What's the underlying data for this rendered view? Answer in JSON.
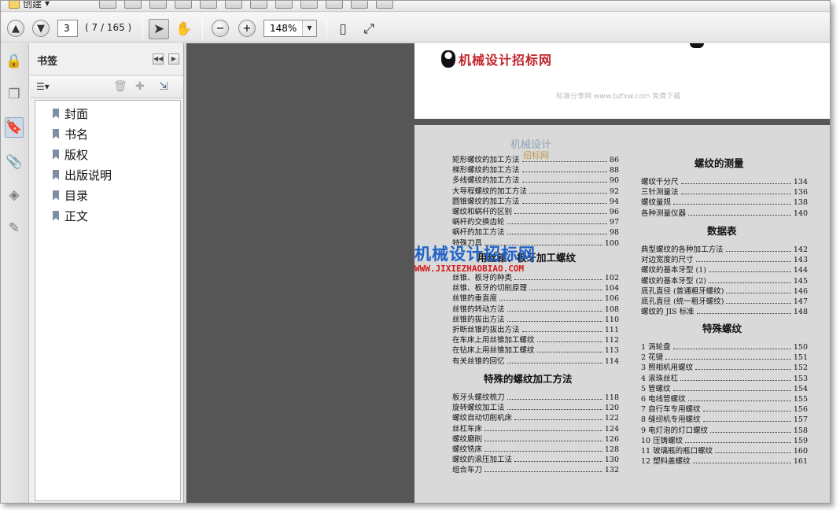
{
  "toolbar": {
    "create_label": "创建",
    "current_page": "3",
    "page_count": "( 7 / 165 )",
    "zoom": "148%"
  },
  "bookmarks": {
    "title": "书签",
    "items": [
      "封面",
      "书名",
      "版权",
      "出版说明",
      "目录",
      "正文"
    ]
  },
  "page1": {
    "logo_text": "机械设计招标网",
    "watermark": "标准分享网  www.bzfxw.com  免费下载"
  },
  "page2": {
    "watermark_top": "机械设计",
    "watermark_top2": "招标网",
    "watermark_mid": "机械设计招标网",
    "watermark_url": "WWW.JIXIEZHAOBIAO.COM",
    "left_col_top": [
      {
        "label": "矩形螺纹的加工方法",
        "page": "86"
      },
      {
        "label": "梯形螺纹的加工方法",
        "page": "88"
      },
      {
        "label": "多线螺纹的加工方法",
        "page": "90"
      },
      {
        "label": "大导程螺纹的加工方法",
        "page": "92"
      },
      {
        "label": "圆锥螺纹的加工方法",
        "page": "94"
      },
      {
        "label": "螺纹和蜗杆的区别",
        "page": "96"
      },
      {
        "label": "蜗杆的交换齿轮",
        "page": "97"
      },
      {
        "label": "蜗杆的加工方法",
        "page": "98"
      },
      {
        "label": "特殊刀具",
        "page": "100"
      }
    ],
    "section_tap": "用丝锥、板牙加工螺纹",
    "left_col_tap": [
      {
        "label": "丝锥、板牙的种类",
        "page": "102"
      },
      {
        "label": "丝锥、板牙的切削原理",
        "page": "104"
      },
      {
        "label": "丝锥的垂直度",
        "page": "106"
      },
      {
        "label": "丝锥的转动方法",
        "page": "108"
      },
      {
        "label": "丝锥的拔出方法",
        "page": "110"
      },
      {
        "label": "折断丝锥的拔出方法",
        "page": "111"
      },
      {
        "label": "在车床上用丝锥加工螺纹",
        "page": "112"
      },
      {
        "label": "在钻床上用丝锥加工螺纹",
        "page": "113"
      },
      {
        "label": "有关丝锥的回忆",
        "page": "114"
      }
    ],
    "section_special_methods": "特殊的螺纹加工方法",
    "left_col_special": [
      {
        "label": "板牙头螺纹梳刀",
        "page": "118"
      },
      {
        "label": "旋转螺纹加工法",
        "page": "120"
      },
      {
        "label": "螺纹自动切削机床",
        "page": "122"
      },
      {
        "label": "丝杠车床",
        "page": "124"
      },
      {
        "label": "螺纹磨削",
        "page": "126"
      },
      {
        "label": "螺纹铣床",
        "page": "128"
      },
      {
        "label": "螺纹的滚压加工法",
        "page": "130"
      },
      {
        "label": "组合车刀",
        "page": "132"
      }
    ],
    "section_measure": "螺纹的测量",
    "right_col_measure": [
      {
        "label": "螺纹千分尺",
        "page": "134"
      },
      {
        "label": "三针测量法",
        "page": "136"
      },
      {
        "label": "螺纹量规",
        "page": "138"
      },
      {
        "label": "各种测量仪器",
        "page": "140"
      }
    ],
    "section_data": "数据表",
    "right_col_data": [
      {
        "label": "典型螺纹的各种加工方法",
        "page": "142"
      },
      {
        "label": "对边宽度的尺寸",
        "page": "143"
      },
      {
        "label": "螺纹的基本牙型 (1)",
        "page": "144"
      },
      {
        "label": "螺纹的基本牙型 (2)",
        "page": "145"
      },
      {
        "label": "底孔直径 (普通粗牙螺纹)",
        "page": "146"
      },
      {
        "label": "底孔直径 (统一粗牙螺纹)",
        "page": "147"
      },
      {
        "label": "螺纹的 JIS 标准",
        "page": "148"
      }
    ],
    "section_special": "特殊螺纹",
    "right_col_special": [
      {
        "label": "1 涡轮盘",
        "page": "150"
      },
      {
        "label": "2 花键",
        "page": "151"
      },
      {
        "label": "3 照相机用螺纹",
        "page": "152"
      },
      {
        "label": "4 滚珠丝杠",
        "page": "153"
      },
      {
        "label": "5 管螺纹",
        "page": "154"
      },
      {
        "label": "6 电线管螺纹",
        "page": "155"
      },
      {
        "label": "7 自行车专用螺纹",
        "page": "156"
      },
      {
        "label": "8 缝纫机专用螺纹",
        "page": "157"
      },
      {
        "label": "9 电灯泡的灯口螺纹",
        "page": "158"
      },
      {
        "label": "10 压铸螺纹",
        "page": "159"
      },
      {
        "label": "11 玻璃瓶的瓶口螺纹",
        "page": "160"
      },
      {
        "label": "12 塑料盖螺纹",
        "page": "161"
      }
    ]
  }
}
